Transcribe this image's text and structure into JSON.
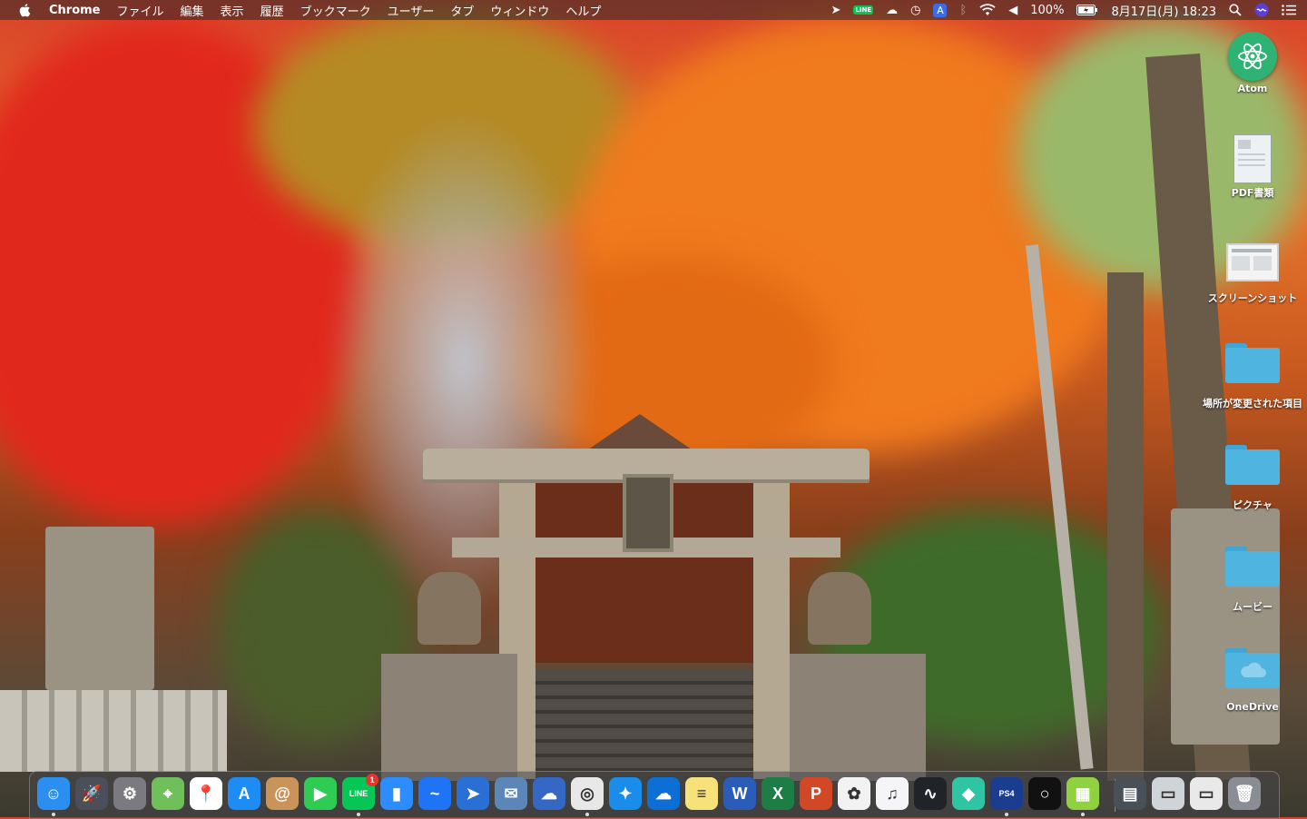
{
  "menubar": {
    "app_name": "Chrome",
    "menus": [
      "ファイル",
      "編集",
      "表示",
      "履歴",
      "ブックマーク",
      "ユーザー",
      "タブ",
      "ウィンドウ",
      "ヘルプ"
    ],
    "status": {
      "line_label": "LINE",
      "input_source": "A",
      "battery": "100%",
      "datetime": "8月17日(月) 18:23"
    }
  },
  "desktop_icons": [
    {
      "label": "Atom",
      "icon": "atom-icon"
    },
    {
      "label": "PDF書類",
      "icon": "pdf-document-icon"
    },
    {
      "label": "スクリーンショット",
      "icon": "screenshot-icon"
    },
    {
      "label": "場所が変更された項目",
      "icon": "folder-icon"
    },
    {
      "label": "ピクチャ",
      "icon": "folder-icon"
    },
    {
      "label": "ムービー",
      "icon": "folder-icon"
    },
    {
      "label": "OneDrive",
      "icon": "onedrive-folder-icon"
    }
  ],
  "dock": {
    "items": [
      {
        "name": "finder",
        "glyph": "☺",
        "color": "#2a8ff0"
      },
      {
        "name": "launchpad",
        "glyph": "🚀",
        "color": "#4a4f5a"
      },
      {
        "name": "system-preferences",
        "glyph": "⚙",
        "color": "#7a7a80"
      },
      {
        "name": "maps",
        "glyph": "⌖",
        "color": "#6fbf5a"
      },
      {
        "name": "google-maps",
        "glyph": "📍",
        "color": "#ffffff"
      },
      {
        "name": "app-store",
        "glyph": "A",
        "color": "#1d8cf5"
      },
      {
        "name": "contacts",
        "glyph": "@",
        "color": "#c8945a"
      },
      {
        "name": "facetime",
        "glyph": "▶",
        "color": "#2ecc52"
      },
      {
        "name": "line",
        "glyph": "LINE",
        "color": "#06c755",
        "badge": "1"
      },
      {
        "name": "zoom",
        "glyph": "▮",
        "color": "#2d8cff"
      },
      {
        "name": "messenger",
        "glyph": "~",
        "color": "#1f74f5"
      },
      {
        "name": "send",
        "glyph": "➤",
        "color": "#2a6fd6"
      },
      {
        "name": "preview",
        "glyph": "✉",
        "color": "#5d86b8"
      },
      {
        "name": "cloud-app",
        "glyph": "☁",
        "color": "#3568c4"
      },
      {
        "name": "chrome",
        "glyph": "◎",
        "color": "#e8e8e8"
      },
      {
        "name": "safari",
        "glyph": "✦",
        "color": "#1a8dea"
      },
      {
        "name": "onedrive",
        "glyph": "☁",
        "color": "#0d6fd6"
      },
      {
        "name": "notes",
        "glyph": "≡",
        "color": "#f7e27a"
      },
      {
        "name": "word",
        "glyph": "W",
        "color": "#2b5cb8"
      },
      {
        "name": "excel",
        "glyph": "X",
        "color": "#1e7d45"
      },
      {
        "name": "powerpoint",
        "glyph": "P",
        "color": "#d24726"
      },
      {
        "name": "photos",
        "glyph": "✿",
        "color": "#f2f2f2"
      },
      {
        "name": "music",
        "glyph": "♫",
        "color": "#f5f5f7"
      },
      {
        "name": "activity-monitor",
        "glyph": "∿",
        "color": "#202428"
      },
      {
        "name": "sourcetree",
        "glyph": "◆",
        "color": "#2fc4a4"
      },
      {
        "name": "ps4-remote-play",
        "glyph": "PS4",
        "color": "#1a3d8f"
      },
      {
        "name": "obs",
        "glyph": "○",
        "color": "#111111"
      },
      {
        "name": "bluestacks",
        "glyph": "▦",
        "color": "#8fd13f"
      },
      {
        "name": "recent-app",
        "glyph": "▤",
        "color": "#4a5058"
      },
      {
        "name": "recent-window-1",
        "glyph": "▭",
        "color": "#cfd4d8"
      },
      {
        "name": "recent-window-2",
        "glyph": "▭",
        "color": "#e9e9e9"
      },
      {
        "name": "trash",
        "glyph": "🗑",
        "color": "#8a8e94"
      }
    ]
  }
}
